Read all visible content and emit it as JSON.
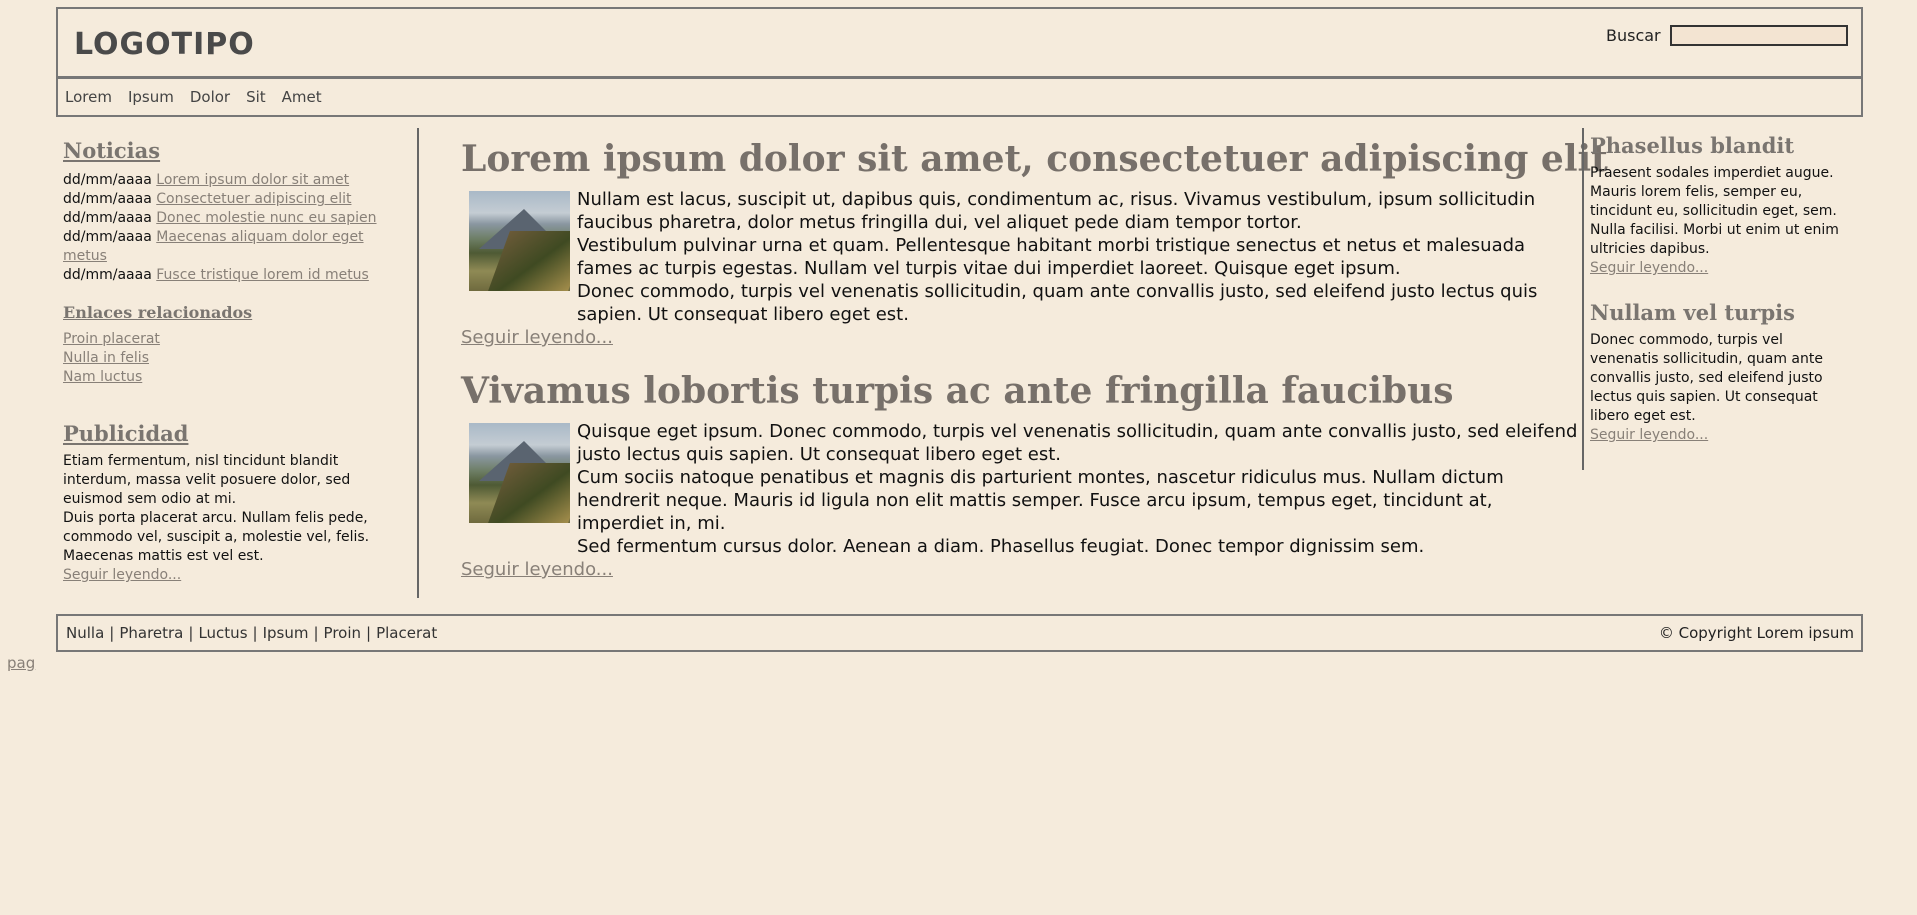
{
  "header": {
    "logo": "LOGOTIPO",
    "search_label": "Buscar",
    "search_value": ""
  },
  "nav": {
    "items": [
      "Lorem",
      "Ipsum",
      "Dolor",
      "Sit",
      "Amet"
    ]
  },
  "left": {
    "news_heading": "Noticias",
    "news": [
      {
        "date": "dd/mm/aaaa",
        "link": "Lorem ipsum dolor sit amet"
      },
      {
        "date": "dd/mm/aaaa",
        "link": "Consectetuer adipiscing elit"
      },
      {
        "date": "dd/mm/aaaa",
        "link": "Donec molestie nunc eu sapien"
      },
      {
        "date": "dd/mm/aaaa",
        "link": "Maecenas aliquam dolor eget metus"
      },
      {
        "date": "dd/mm/aaaa",
        "link": "Fusce tristique lorem id metus"
      }
    ],
    "links_heading": "Enlaces relacionados",
    "links": [
      "Proin placerat",
      "Nulla in felis",
      "Nam luctus"
    ],
    "ad_heading": "Publicidad",
    "ad_paragraphs": [
      "Etiam fermentum, nisl tincidunt blandit interdum, massa velit posuere dolor, sed euismod sem odio at mi.",
      "Duis porta placerat arcu. Nullam felis pede, commodo vel, suscipit a, molestie vel, felis. Maecenas mattis est vel est."
    ],
    "ad_more": "Seguir leyendo..."
  },
  "main": {
    "articles": [
      {
        "title": "Lorem ipsum dolor sit amet, consectetuer adipiscing elit",
        "paragraphs": [
          "Nullam est lacus, suscipit ut, dapibus quis, condimentum ac, risus. Vivamus vestibulum, ipsum sollicitudin faucibus pharetra, dolor metus fringilla dui, vel aliquet pede diam tempor tortor.",
          "Vestibulum pulvinar urna et quam. Pellentesque habitant morbi tristique senectus et netus et malesuada fames ac turpis egestas. Nullam vel turpis vitae dui imperdiet laoreet. Quisque eget ipsum.",
          "Donec commodo, turpis vel venenatis sollicitudin, quam ante convallis justo, sed eleifend justo lectus quis sapien. Ut consequat libero eget est."
        ],
        "more": "Seguir leyendo..."
      },
      {
        "title": "Vivamus lobortis turpis ac ante fringilla faucibus",
        "paragraphs": [
          "Quisque eget ipsum. Donec commodo, turpis vel venenatis sollicitudin, quam ante convallis justo, sed eleifend justo lectus quis sapien. Ut consequat libero eget est.",
          "Cum sociis natoque penatibus et magnis dis parturient montes, nascetur ridiculus mus. Nullam dictum hendrerit neque. Mauris id ligula non elit mattis semper. Fusce arcu ipsum, tempus eget, tincidunt at, imperdiet in, mi.",
          "Sed fermentum cursus dolor. Aenean a diam. Phasellus feugiat. Donec tempor dignissim sem."
        ],
        "more": "Seguir leyendo..."
      }
    ]
  },
  "right": {
    "blocks": [
      {
        "title": "Phasellus blandit",
        "text": "Praesent sodales imperdiet augue. Mauris lorem felis, semper eu, tincidunt eu, sollicitudin eget, sem. Nulla facilisi. Morbi ut enim ut enim ultricies dapibus.",
        "more": "Seguir leyendo..."
      },
      {
        "title": "Nullam vel turpis",
        "text": "Donec commodo, turpis vel venenatis sollicitudin, quam ante convallis justo, sed eleifend justo lectus quis sapien. Ut consequat libero eget est.",
        "more": "Seguir leyendo..."
      }
    ]
  },
  "footer": {
    "links": [
      "Nulla",
      "Pharetra",
      "Luctus",
      "Ipsum",
      "Proin",
      "Placerat"
    ],
    "separator": "|",
    "copyright": "© Copyright Lorem ipsum"
  },
  "pag": "pag"
}
